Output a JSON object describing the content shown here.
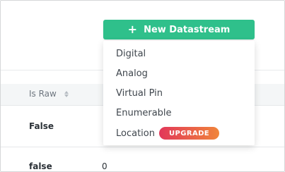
{
  "toolbar": {
    "new_datastream_button": "New Datastream",
    "plus_glyph": "+"
  },
  "dropdown": {
    "items": [
      {
        "label": "Digital"
      },
      {
        "label": "Analog"
      },
      {
        "label": "Virtual Pin"
      },
      {
        "label": "Enumerable"
      },
      {
        "label": "Location",
        "badge": "UPGRADE"
      }
    ]
  },
  "table": {
    "columns": [
      {
        "label": "Is Raw",
        "sort_icon": "sort-icon"
      }
    ],
    "rows": [
      {
        "is_raw": "False"
      },
      {
        "is_raw": "false",
        "value": "0"
      }
    ]
  },
  "colors": {
    "primary_button": "#2fc08b",
    "badge_gradient_start": "#e2375a",
    "badge_gradient_end": "#f0853a"
  }
}
